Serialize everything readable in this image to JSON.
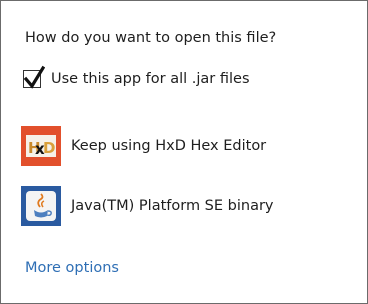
{
  "dialog": {
    "title": "How do you want to open this file?",
    "always_use": {
      "label": "Use this app for all .jar files",
      "checked": true
    },
    "apps": [
      {
        "label": "Keep using HxD Hex Editor",
        "icon": "hxd-hex-editor-icon"
      },
      {
        "label": "Java(TM) Platform SE binary",
        "icon": "java-icon"
      }
    ],
    "more_options": "More options"
  },
  "colors": {
    "link": "#2f6fb5",
    "hxd_tile": "#e2502c",
    "java_tile": "#2a5aa0"
  }
}
